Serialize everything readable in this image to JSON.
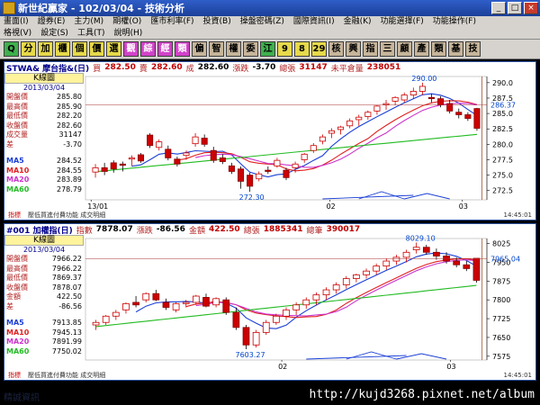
{
  "window": {
    "title": "新世紀贏家 - 102/03/04 - 技術分析",
    "min": "_",
    "max": "□",
    "close": "×"
  },
  "menu": {
    "row1": [
      "畫面(I)",
      "證券(E)",
      "主力(M)",
      "期權(O)",
      "匯市利率(F)",
      "投資(B)",
      "操盤密碼(Z)",
      "國際資訊(I)",
      "金融(K)",
      "功能選擇(F)",
      "功能操作(F)"
    ],
    "row2": [
      "格視(V)",
      "設定(S)",
      "工具(T)",
      "說明(H)"
    ]
  },
  "toolbar": [
    {
      "label": "Q",
      "color": "green"
    },
    {
      "label": "分",
      "color": "yellow"
    },
    {
      "label": "加",
      "color": "yellow"
    },
    {
      "label": "櫃",
      "color": "yellow"
    },
    {
      "label": "個",
      "color": "yellow"
    },
    {
      "label": "價",
      "color": "yellow"
    },
    {
      "label": "選",
      "color": "yellow"
    },
    {
      "label": "觀",
      "color": "magenta"
    },
    {
      "label": "綜",
      "color": "magenta"
    },
    {
      "label": "經",
      "color": "magenta"
    },
    {
      "label": "類",
      "color": "magenta"
    },
    {
      "label": "偏",
      "color": "tan"
    },
    {
      "label": "智",
      "color": "tan"
    },
    {
      "label": "權",
      "color": "tan"
    },
    {
      "label": "委",
      "color": "tan"
    },
    {
      "label": "江",
      "color": "green"
    },
    {
      "label": "9",
      "color": "yellow"
    },
    {
      "label": "8",
      "color": "yellow"
    },
    {
      "label": "29",
      "color": "yellow"
    },
    {
      "label": "核",
      "color": "tan"
    },
    {
      "label": "興",
      "color": "tan"
    },
    {
      "label": "指",
      "color": "tan"
    },
    {
      "label": "三",
      "color": "tan"
    },
    {
      "label": "顧",
      "color": "tan"
    },
    {
      "label": "產",
      "color": "tan"
    },
    {
      "label": "類",
      "color": "tan"
    },
    {
      "label": "基",
      "color": "tan"
    },
    {
      "label": "技",
      "color": "tan"
    }
  ],
  "panel1": {
    "header": {
      "symbol": "STWA& 摩台指&(日)",
      "bid_label": "買",
      "bid": "282.50",
      "ask_label": "賣",
      "ask": "282.60",
      "deal_label": "成",
      "deal": "282.60",
      "chg_label": "漲跌",
      "chg": "-3.70",
      "vol_label": "總張",
      "vol": "31147",
      "oi_label": "未平倉量",
      "oi": "238051"
    },
    "info": {
      "title": "K線圖",
      "date": "2013/03/04",
      "rows": [
        {
          "k": "開盤價",
          "v": "285.80"
        },
        {
          "k": "最高價",
          "v": "285.90"
        },
        {
          "k": "最低價",
          "v": "282.20"
        },
        {
          "k": "收盤價",
          "v": "282.60"
        },
        {
          "k": "成交量",
          "v": "31147"
        },
        {
          "k": "差",
          "v": "-3.70"
        }
      ],
      "ma": [
        {
          "k": "MA5",
          "v": "284.52",
          "color": "#1a3fd6"
        },
        {
          "k": "MA10",
          "v": "284.55",
          "color": "#e02020"
        },
        {
          "k": "MA20",
          "v": "283.89",
          "color": "#cc33cc"
        },
        {
          "k": "MA60",
          "v": "278.79",
          "color": "#22bb22"
        }
      ]
    },
    "axis": {
      "ticks": [
        "290.0",
        "287.5",
        "285.0",
        "282.5",
        "280.0",
        "277.5",
        "275.0",
        "272.5"
      ],
      "current": "286.37",
      "high_label": "290.00",
      "low_label": "272.30",
      "x_labels": [
        "13/01",
        "02",
        "03"
      ]
    },
    "status": {
      "left": "指標",
      "mid": "壓低買進付費功能  成交明細",
      "right": "14:45:01"
    }
  },
  "panel2": {
    "header": {
      "symbol": "#001 加權指(日)",
      "idx_label": "指數",
      "idx": "7878.07",
      "chg_label": "漲跌",
      "chg": "-86.56",
      "amt_label": "金額",
      "amt": "422.50",
      "vol_label": "總張",
      "vol": "1885341",
      "diff_label": "總筆",
      "diff": "390017"
    },
    "info": {
      "title": "K線圖",
      "date": "2013/03/04",
      "rows": [
        {
          "k": "開盤價",
          "v": "7966.22"
        },
        {
          "k": "最高價",
          "v": "7966.22"
        },
        {
          "k": "最低價",
          "v": "7869.37"
        },
        {
          "k": "收盤價",
          "v": "7878.07"
        },
        {
          "k": "金額",
          "v": "422.50"
        },
        {
          "k": "差",
          "v": "-86.56"
        }
      ],
      "ma": [
        {
          "k": "MA5",
          "v": "7913.85",
          "color": "#1a3fd6"
        },
        {
          "k": "MA10",
          "v": "7945.13",
          "color": "#e02020"
        },
        {
          "k": "MA20",
          "v": "7891.99",
          "color": "#cc33cc"
        },
        {
          "k": "MA60",
          "v": "7750.02",
          "color": "#22bb22"
        }
      ]
    },
    "axis": {
      "ticks": [
        "8025",
        "7950",
        "7875",
        "7800",
        "7725",
        "7650",
        "7575"
      ],
      "current": "7965.04",
      "high_label": "8029.10",
      "low_label": "7603.27",
      "x_labels": [
        "02",
        "03"
      ]
    },
    "status": {
      "left": "指標",
      "mid": "壓低買進付費功能  成交明細",
      "right": "14:45:01"
    }
  },
  "footer": {
    "watermark": "http://kujd3268.pixnet.net/album",
    "faded": "精誠資訊"
  },
  "chart_data": [
    {
      "type": "candlestick",
      "title": "STWA& 摩台指&(日)",
      "ylim": [
        271,
        291
      ],
      "ticks": [
        290.0,
        287.5,
        285.0,
        282.5,
        280.0,
        277.5,
        275.0,
        272.5
      ],
      "ohlc": [
        [
          275.5,
          276.8,
          274.6,
          276.2
        ],
        [
          276.2,
          277.0,
          275.0,
          275.6
        ],
        [
          277.0,
          277.4,
          275.4,
          276.0
        ],
        [
          276.8,
          277.2,
          275.6,
          276.6
        ],
        [
          277.6,
          278.2,
          276.5,
          277.8
        ],
        [
          278.3,
          278.6,
          277.0,
          277.3
        ],
        [
          281.5,
          281.8,
          279.4,
          279.8
        ],
        [
          279.5,
          280.8,
          279.0,
          280.4
        ],
        [
          279.2,
          279.8,
          277.4,
          277.8
        ],
        [
          277.6,
          278.0,
          276.4,
          276.8
        ],
        [
          278.2,
          279.0,
          277.5,
          278.6
        ],
        [
          280.1,
          281.8,
          279.6,
          281.2
        ],
        [
          281.0,
          281.6,
          279.6,
          280.0
        ],
        [
          279.0,
          279.6,
          277.0,
          277.4
        ],
        [
          277.8,
          278.4,
          276.8,
          277.2
        ],
        [
          276.5,
          277.0,
          275.2,
          275.6
        ],
        [
          276.0,
          276.4,
          272.8,
          274.0
        ],
        [
          275.0,
          275.4,
          272.3,
          273.2
        ],
        [
          274.4,
          275.6,
          274.0,
          275.2
        ],
        [
          275.8,
          276.4,
          275.2,
          275.6
        ],
        [
          276.5,
          277.8,
          276.2,
          277.4
        ],
        [
          275.8,
          276.2,
          274.2,
          274.6
        ],
        [
          276.2,
          277.2,
          275.4,
          276.8
        ],
        [
          277.5,
          278.6,
          277.0,
          278.4
        ],
        [
          279.0,
          280.2,
          278.6,
          279.8
        ],
        [
          280.5,
          281.6,
          280.0,
          281.2
        ],
        [
          281.8,
          282.6,
          281.0,
          282.2
        ],
        [
          282.4,
          283.0,
          281.6,
          282.8
        ],
        [
          283.0,
          284.2,
          282.6,
          283.8
        ],
        [
          284.0,
          284.8,
          283.0,
          284.4
        ],
        [
          284.5,
          285.5,
          284.0,
          285.2
        ],
        [
          285.4,
          286.4,
          284.8,
          286.2
        ],
        [
          286.4,
          287.2,
          285.6,
          286.6
        ],
        [
          287.0,
          287.8,
          286.4,
          287.6
        ],
        [
          287.2,
          288.4,
          286.8,
          288.0
        ],
        [
          288.0,
          289.2,
          287.4,
          288.6
        ],
        [
          288.6,
          290.0,
          288.0,
          289.4
        ],
        [
          287.6,
          288.2,
          286.8,
          287.4
        ],
        [
          287.4,
          287.8,
          286.0,
          286.4
        ],
        [
          286.6,
          287.2,
          285.0,
          285.4
        ],
        [
          285.2,
          285.8,
          284.2,
          284.8
        ],
        [
          284.8,
          285.2,
          283.8,
          284.2
        ],
        [
          285.8,
          285.9,
          282.2,
          282.6
        ]
      ]
    },
    {
      "type": "candlestick",
      "title": "#001 加權指(日)",
      "ylim": [
        7560,
        8045
      ],
      "ticks": [
        8025,
        7950,
        7875,
        7800,
        7725,
        7650,
        7575
      ],
      "ohlc": [
        [
          7700,
          7720,
          7680,
          7710
        ],
        [
          7710,
          7740,
          7700,
          7735
        ],
        [
          7735,
          7760,
          7720,
          7750
        ],
        [
          7760,
          7790,
          7745,
          7785
        ],
        [
          7790,
          7815,
          7770,
          7780
        ],
        [
          7800,
          7830,
          7790,
          7825
        ],
        [
          7825,
          7840,
          7795,
          7800
        ],
        [
          7790,
          7805,
          7760,
          7770
        ],
        [
          7760,
          7790,
          7750,
          7785
        ],
        [
          7785,
          7800,
          7770,
          7790
        ],
        [
          7790,
          7820,
          7780,
          7815
        ],
        [
          7810,
          7825,
          7770,
          7775
        ],
        [
          7780,
          7810,
          7770,
          7805
        ],
        [
          7800,
          7810,
          7740,
          7750
        ],
        [
          7750,
          7770,
          7680,
          7690
        ],
        [
          7690,
          7700,
          7603,
          7620
        ],
        [
          7620,
          7680,
          7610,
          7670
        ],
        [
          7670,
          7720,
          7660,
          7710
        ],
        [
          7710,
          7745,
          7700,
          7735
        ],
        [
          7735,
          7770,
          7720,
          7760
        ],
        [
          7760,
          7790,
          7740,
          7780
        ],
        [
          7780,
          7810,
          7765,
          7800
        ],
        [
          7800,
          7830,
          7780,
          7820
        ],
        [
          7820,
          7850,
          7800,
          7840
        ],
        [
          7840,
          7870,
          7825,
          7860
        ],
        [
          7860,
          7895,
          7845,
          7885
        ],
        [
          7885,
          7905,
          7870,
          7900
        ],
        [
          7900,
          7925,
          7885,
          7915
        ],
        [
          7915,
          7945,
          7900,
          7935
        ],
        [
          7935,
          7965,
          7920,
          7955
        ],
        [
          7955,
          7980,
          7940,
          7970
        ],
        [
          7970,
          8000,
          7950,
          7990
        ],
        [
          8000,
          8029,
          7985,
          8010
        ],
        [
          8010,
          8020,
          7980,
          7990
        ],
        [
          7990,
          8005,
          7960,
          7975
        ],
        [
          7975,
          7990,
          7945,
          7955
        ],
        [
          7955,
          7970,
          7930,
          7940
        ],
        [
          7940,
          7955,
          7915,
          7925
        ],
        [
          7966,
          7966,
          7869,
          7878
        ]
      ]
    }
  ]
}
